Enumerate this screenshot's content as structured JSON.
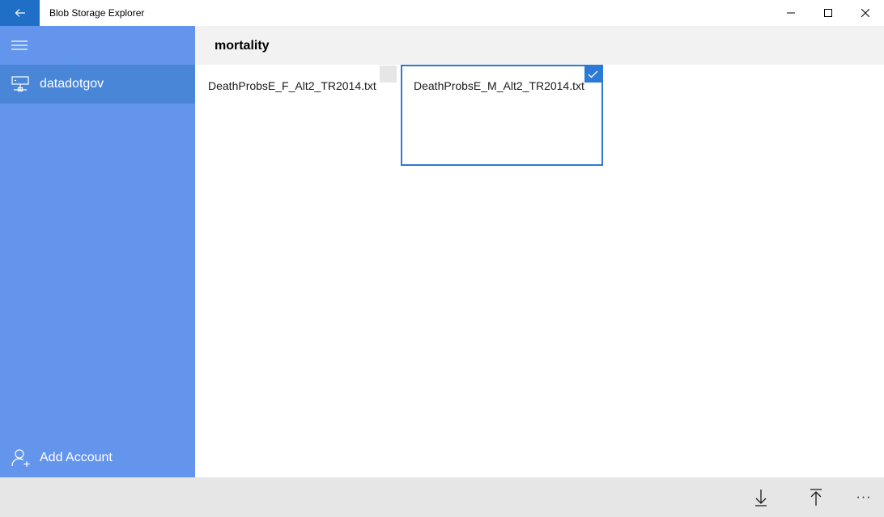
{
  "window": {
    "title": "Blob Storage Explorer"
  },
  "sidebar": {
    "items": [
      {
        "label": "datadotgov",
        "icon": "storage-account-icon",
        "selected": true
      }
    ],
    "add_account_label": "Add Account"
  },
  "header": {
    "title": "mortality"
  },
  "files": [
    {
      "name": "DeathProbsE_F_Alt2_TR2014.txt",
      "selected": false
    },
    {
      "name": "DeathProbsE_M_Alt2_TR2014.txt",
      "selected": true
    }
  ],
  "commandbar": {
    "more_label": "···"
  },
  "colors": {
    "accent": "#1f6fc6",
    "sidebar": "#6495ed",
    "sidebar_selected": "#4a86d8",
    "selection": "#2a7ad6",
    "header_bg": "#f2f2f2",
    "commandbar_bg": "#e6e6e6"
  }
}
